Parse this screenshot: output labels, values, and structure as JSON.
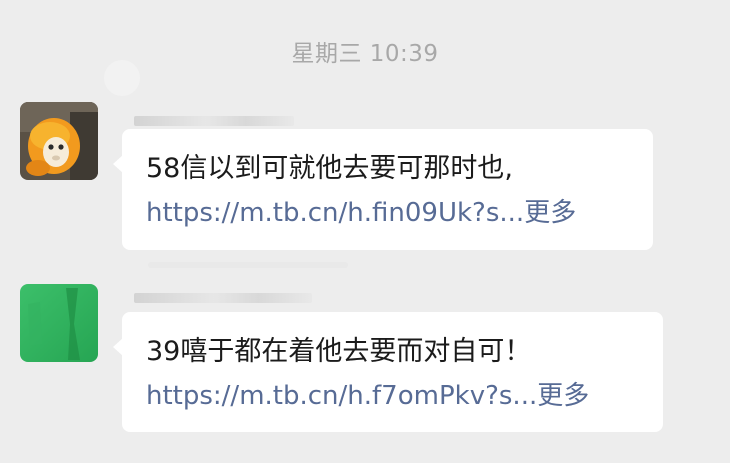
{
  "chat": {
    "timestamp": "星期三 10:39",
    "messages": [
      {
        "avatar": "orange-monkey-avatar",
        "text": "58信以到可就他去要可那时也,",
        "link": "https://m.tb.cn/h.fin09Uk?s...",
        "more": "更多"
      },
      {
        "avatar": "green-avatar",
        "text": "39嘻于都在着他去要而对自可！",
        "link": "https://m.tb.cn/h.f7omPkv?s...",
        "more": "更多"
      }
    ]
  },
  "colors": {
    "background": "#ededed",
    "bubble": "#ffffff",
    "link": "#576b95",
    "timestamp": "#a8a8a8",
    "text": "#1b1b1b"
  }
}
